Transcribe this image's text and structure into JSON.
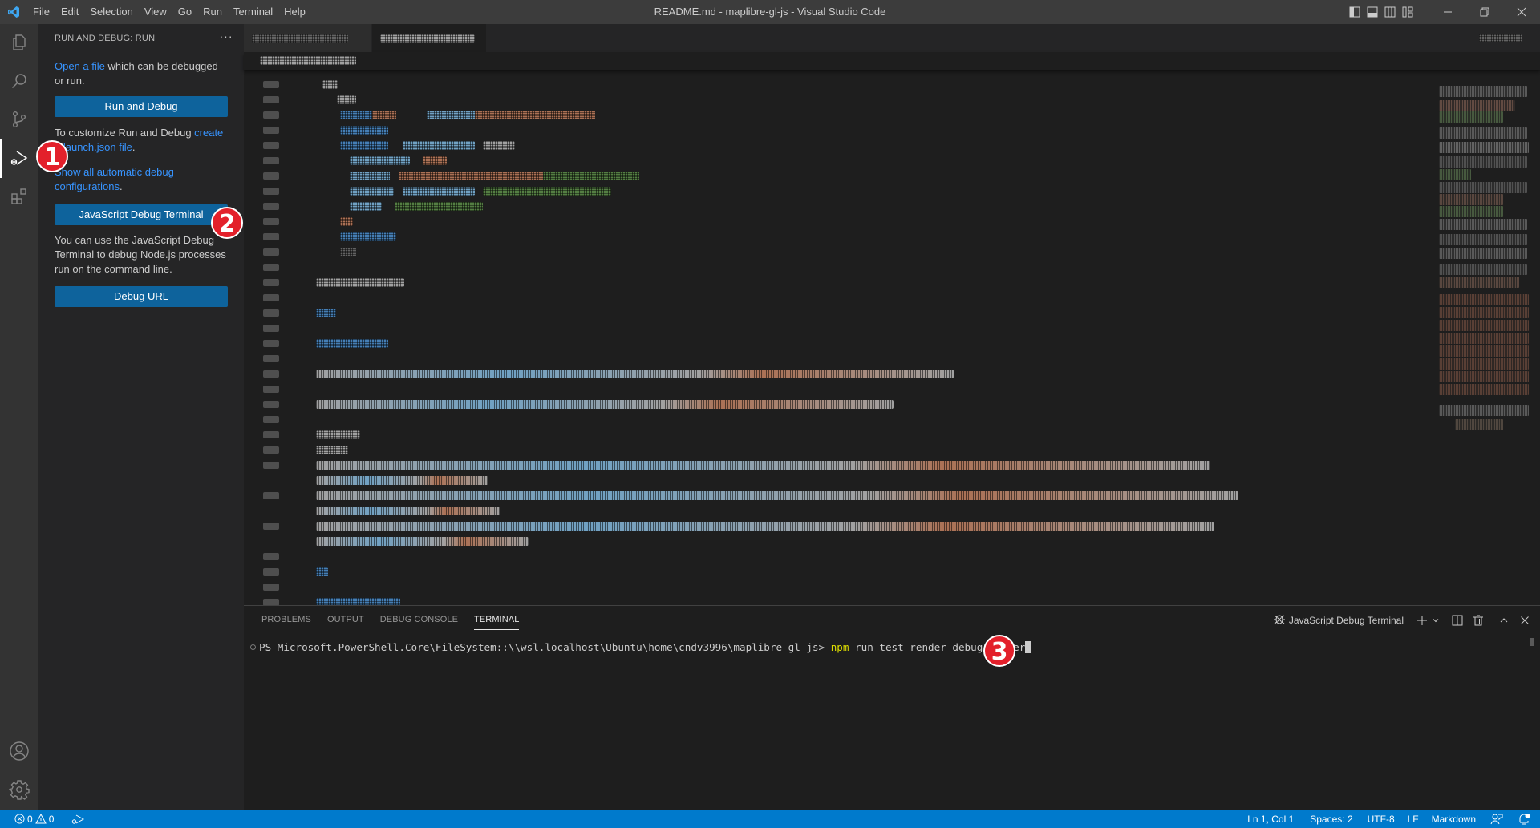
{
  "titlebar": {
    "window_title": "README.md - maplibre-gl-js - Visual Studio Code",
    "menu": [
      "File",
      "Edit",
      "Selection",
      "View",
      "Go",
      "Run",
      "Terminal",
      "Help"
    ],
    "layout_controls": [
      "toggle-primary-sidebar",
      "toggle-panel",
      "toggle-secondary-sidebar",
      "customize-layout"
    ],
    "window_controls": [
      "minimize",
      "restore",
      "close"
    ]
  },
  "activitybar": {
    "items": [
      {
        "name": "explorer",
        "icon": "files-icon",
        "active": false
      },
      {
        "name": "search",
        "icon": "search-icon",
        "active": false
      },
      {
        "name": "source-control",
        "icon": "source-control-icon",
        "active": false
      },
      {
        "name": "run-and-debug",
        "icon": "run-debug-icon",
        "active": true
      },
      {
        "name": "extensions",
        "icon": "extensions-icon",
        "active": false
      }
    ],
    "bottom": [
      {
        "name": "accounts",
        "icon": "account-icon"
      },
      {
        "name": "manage",
        "icon": "gear-icon"
      }
    ]
  },
  "sidebar": {
    "title": "RUN AND DEBUG: RUN",
    "more": "···",
    "open_file_link": "Open a file",
    "open_file_rest": " which can be debugged or run.",
    "run_debug_button": "Run and Debug",
    "customize_text": "To customize Run and Debug ",
    "customize_link": "create a launch.json file",
    "customize_end": ".",
    "show_all_link": "Show all automatic debug configurations",
    "show_all_end": ".",
    "js_debug_terminal_button": "JavaScript Debug Terminal",
    "js_debug_desc": "You can use the JavaScript Debug Terminal to debug Node.js processes run on the command line.",
    "debug_url_button": "Debug URL"
  },
  "annotations": [
    "1",
    "2",
    "3"
  ],
  "editor": {
    "tabs": [
      {
        "label": "[obfuscated]",
        "active": false
      },
      {
        "label": "[obfuscated]",
        "active": true
      }
    ],
    "content_note": "Editor content is obfuscated in the screenshot"
  },
  "panel": {
    "tabs": [
      {
        "label": "PROBLEMS",
        "active": false
      },
      {
        "label": "OUTPUT",
        "active": false
      },
      {
        "label": "DEBUG CONSOLE",
        "active": false
      },
      {
        "label": "TERMINAL",
        "active": true
      }
    ],
    "terminal_name": "JavaScript Debug Terminal",
    "prompt": "PS Microsoft.PowerShell.Core\\FileSystem::\\\\wsl.localhost\\Ubuntu\\home\\cndv3996\\maplibre-gl-js> ",
    "command_npm": "npm",
    "command_rest": " run test-render debug/raster"
  },
  "statusbar": {
    "errors": "0",
    "warnings": "0",
    "position": "Ln 1, Col 1",
    "indent": "Spaces: 2",
    "encoding": "UTF-8",
    "eol": "LF",
    "language": "Markdown"
  }
}
